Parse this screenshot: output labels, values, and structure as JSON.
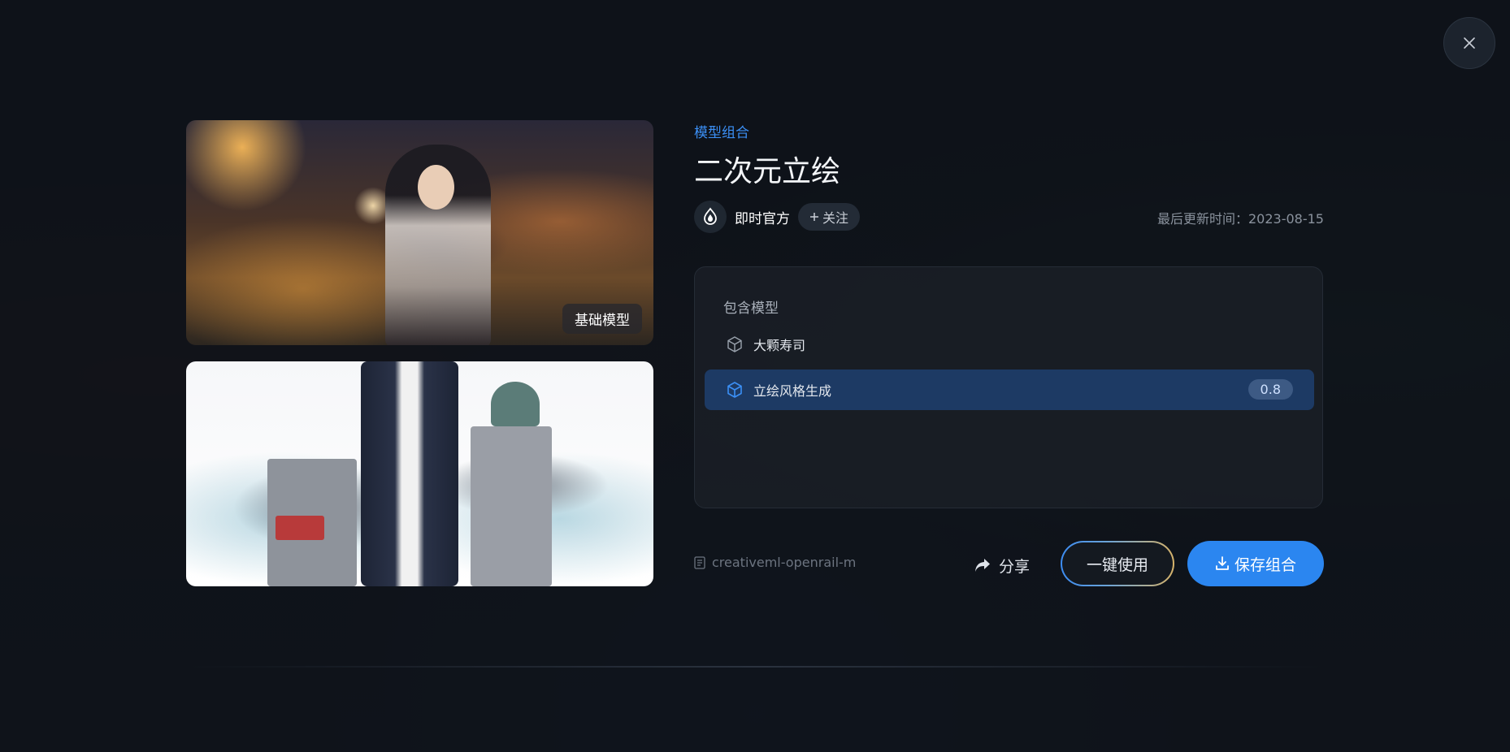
{
  "colors": {
    "accent": "#2b86f0",
    "category": "#3b8ff5",
    "selected_row": "#1d3a64",
    "background": "#0f1318"
  },
  "close": {
    "icon": "close-icon"
  },
  "images": [
    {
      "tag": "基础模型"
    },
    {
      "tag": ""
    }
  ],
  "info": {
    "category": "模型组合",
    "title": "二次元立绘",
    "author": {
      "name": "即时官方",
      "follow_label": "关注",
      "logo_icon": "flame-logo-icon"
    },
    "update_label": "最后更新时间：2023-08-15"
  },
  "models": {
    "header": "包含模型",
    "items": [
      {
        "name": "大颗寿司",
        "icon": "cube-icon",
        "selected": false
      },
      {
        "name": "立绘风格生成",
        "icon": "cube-icon",
        "selected": true,
        "weight": "0.8"
      }
    ]
  },
  "footer": {
    "license": "creativeml-openrail-m",
    "share_label": "分享",
    "use_label": "一键使用",
    "save_label": "保存组合"
  }
}
